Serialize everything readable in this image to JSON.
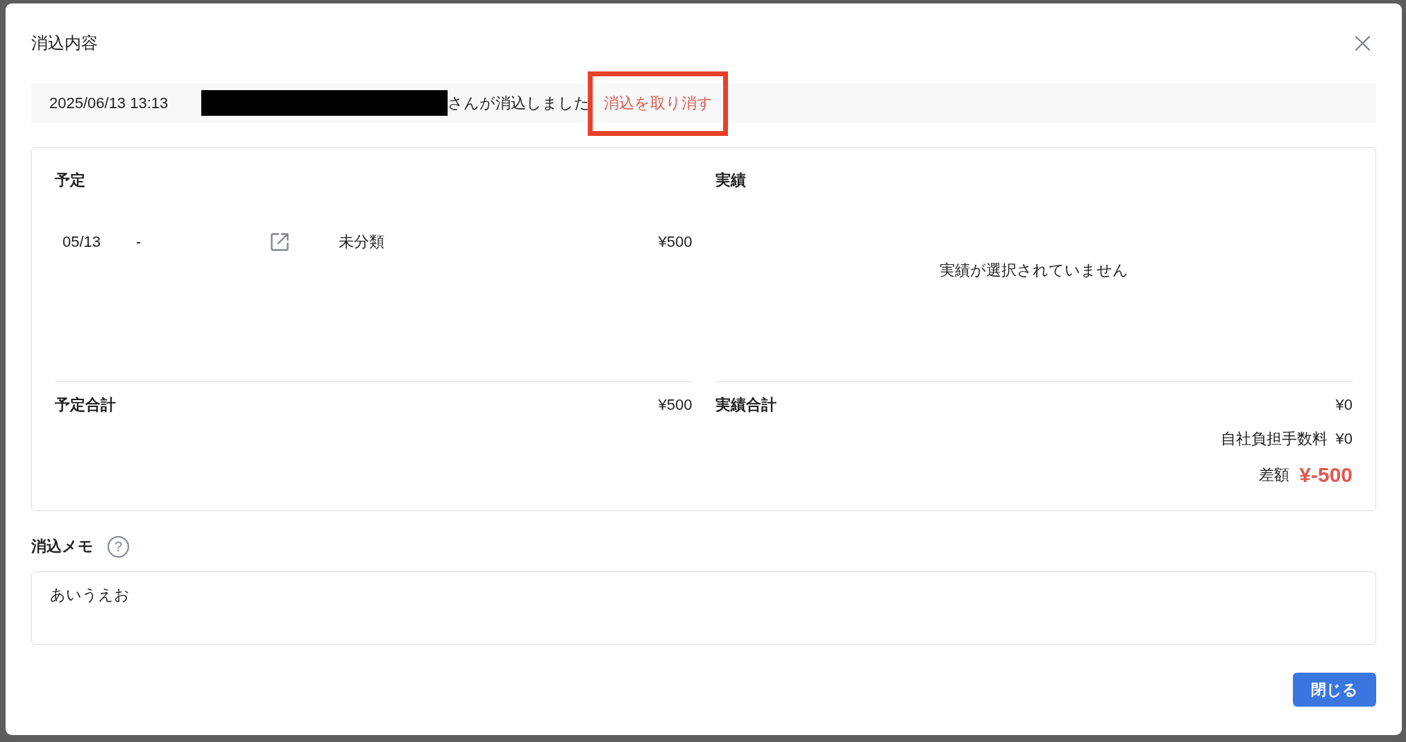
{
  "dialog": {
    "title": "消込内容"
  },
  "history": {
    "timestamp": "2025/06/13 13:13",
    "name_redacted": true,
    "message": "さんが消込しました",
    "undo_link": {
      "label": "消込を取り消す",
      "highlighted": true
    }
  },
  "planned": {
    "heading": "予定",
    "rows": [
      {
        "date": "05/13",
        "column_2": "-",
        "category": "未分類",
        "amount": "¥500"
      }
    ],
    "total": {
      "label": "予定合計",
      "amount": "¥500"
    }
  },
  "actual": {
    "heading": "実績",
    "empty_message": "実績が選択されていません",
    "total": {
      "label": "実績合計",
      "amount": "¥0"
    },
    "fee": {
      "label": "自社負担手数料",
      "amount": "¥0"
    },
    "difference": {
      "label": "差額",
      "amount": "¥-500"
    }
  },
  "memo": {
    "label": "消込メモ",
    "help_glyph": "?",
    "value": "あいうえお"
  },
  "buttons": [
    {
      "label": "閉じる",
      "kind": "primary"
    }
  ]
}
